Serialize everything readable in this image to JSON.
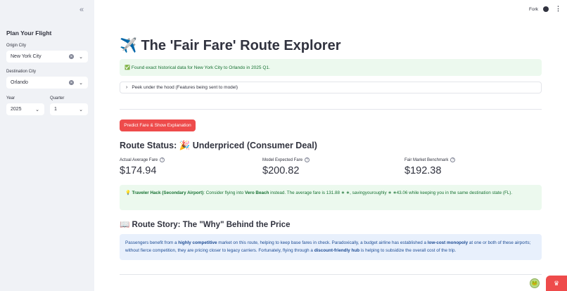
{
  "sidebar": {
    "collapse_icon": "«",
    "title": "Plan Your Flight",
    "origin_label": "Origin City",
    "origin_value": "New York City",
    "destination_label": "Destination City",
    "destination_value": "Orlando",
    "year_label": "Year",
    "year_value": "2025",
    "quarter_label": "Quarter",
    "quarter_value": "1"
  },
  "header": {
    "fork_label": "Fork"
  },
  "main": {
    "title": "✈️ The 'Fair Fare' Route Explorer",
    "success_message": "✅ Found exact historical data for New York City to Orlando in 2025 Q1.",
    "expander_label": "Peek under the hood (Features being sent to model)",
    "predict_button": "Predict Fare & Show Explanation",
    "route_status": "Route Status: 🎉 Underpriced (Consumer Deal)",
    "metrics": [
      {
        "label": "Actual Average Fare",
        "value": "$174.94"
      },
      {
        "label": "Model Expected Fare",
        "value": "$200.82"
      },
      {
        "label": "Fair Market Benchmark",
        "value": "$192.38"
      }
    ],
    "hack": {
      "icon": "💡",
      "title": "Traveler Hack (Secondary Airport)",
      "text_before": ": Consider flying into ",
      "airport": "Vero Beach",
      "text_after": " instead. The average fare is 131.88 ∗ ∗, savingyouroughly ∗ ∗43.06 while keeping you in the same destination state (FL)."
    },
    "story_title": "📖 Route Story: The \"Why\" Behind the Price",
    "story": {
      "p1": "Passengers benefit from a ",
      "b1": "highly competitive",
      "p2": " market on this route, helping to keep base fares in check. Paradoxically, a budget airline has established a ",
      "b2": "low-cost monopoly",
      "p3": " at one or both of these airports; without fierce competition, they are pricing closer to legacy carriers. Fortunately, flying through a ",
      "b3": "discount-friendly hub",
      "p4": " is helping to subsidize the overall cost of the trip."
    }
  },
  "colors": {
    "accent": "#ee4b4b",
    "success_bg": "#ecf9ee",
    "success_text": "#177233",
    "info_bg": "#e8f0fc",
    "sidebar_bg": "#f0f2f6"
  }
}
